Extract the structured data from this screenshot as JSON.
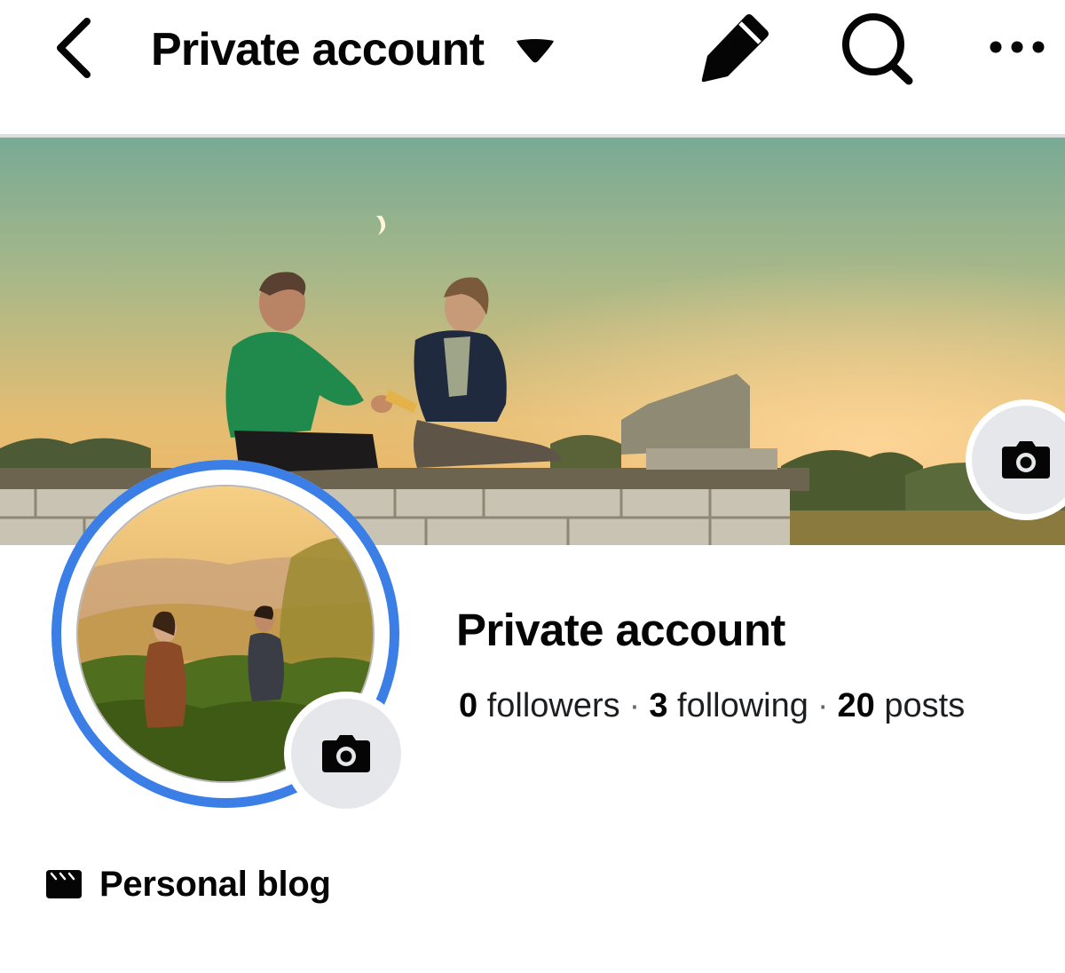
{
  "header": {
    "title": "Private account",
    "icons": {
      "back": "chevron-left-icon",
      "dropdown": "caret-down-icon",
      "edit": "pencil-icon",
      "search": "search-icon",
      "more": "more-horizontal-icon"
    }
  },
  "profile": {
    "name": "Private account",
    "stats": {
      "followers_count": "0",
      "followers_label": "followers",
      "following_count": "3",
      "following_label": "following",
      "posts_count": "20",
      "posts_label": "posts",
      "separator": "·"
    },
    "category": "Personal blog",
    "category_icon": "film-clapper-icon"
  },
  "colors": {
    "accent_ring": "#3a7ee6",
    "icon_button_bg": "#e6e7eb",
    "divider": "#dcdde0",
    "text_primary": "#050505"
  }
}
